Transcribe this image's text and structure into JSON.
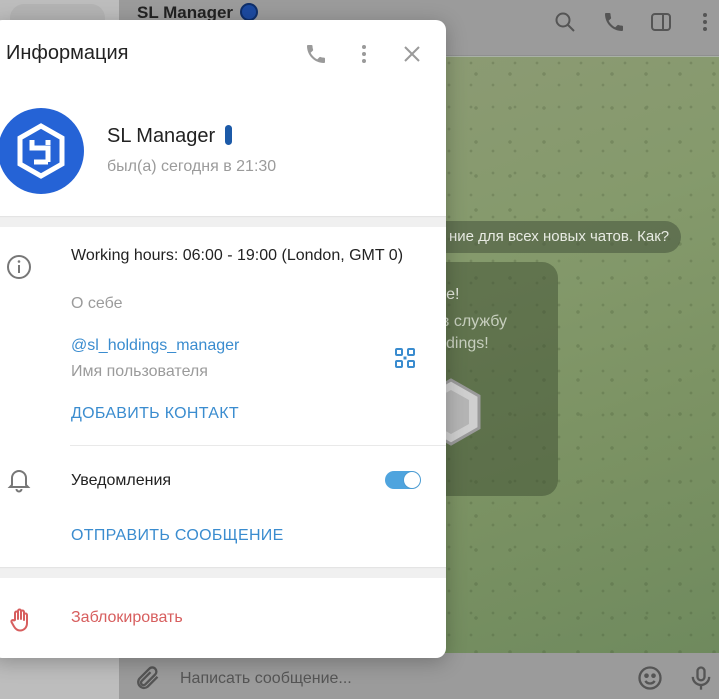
{
  "colors": {
    "accent": "#3a8ccf",
    "danger": "#d75e5e",
    "toggle_on": "#4fa4de",
    "avatar": "#2563d6"
  },
  "background": {
    "chat_header": {
      "title": "SL Manager"
    },
    "messages": {
      "service": "ние для всех новых чатов. Как?",
      "greeting_line1": "уйте!",
      "greeting_line2": ", в службу",
      "greeting_line3": "Holdings!"
    },
    "composer": {
      "placeholder": "Написать сообщение..."
    }
  },
  "modal": {
    "title": "Информация",
    "header_icons": [
      "phone-icon",
      "more-vertical-icon",
      "close-icon"
    ],
    "profile": {
      "name": "SL Manager",
      "status": "был(а) сегодня в 21:30"
    },
    "info": {
      "bio": "Working hours: 06:00 - 19:00 (London, GMT 0)",
      "bio_label": "О себе",
      "username": "@sl_holdings_manager",
      "username_label": "Имя пользователя",
      "add_contact": "ДОБАВИТЬ КОНТАКТ"
    },
    "notifications": {
      "label": "Уведомления",
      "enabled": true
    },
    "send_message": "ОТПРАВИТЬ СООБЩЕНИЕ",
    "block": "Заблокировать"
  }
}
